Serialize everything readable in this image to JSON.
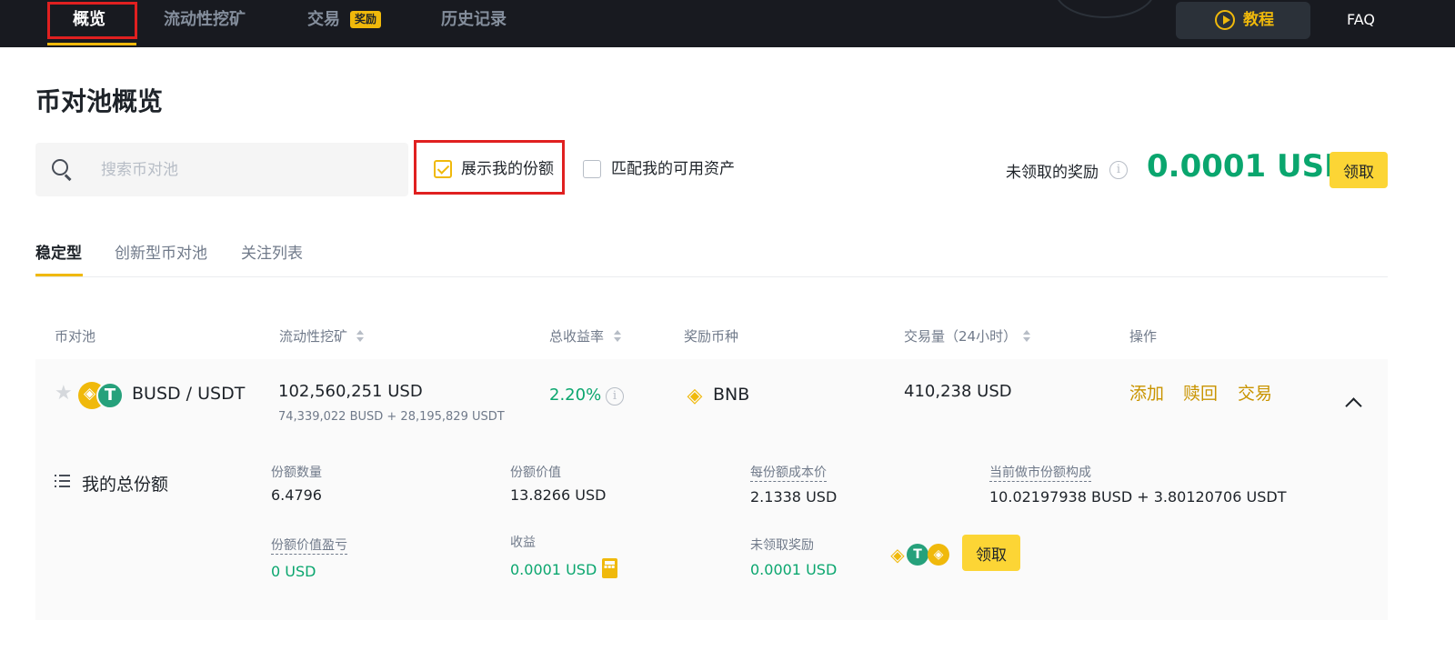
{
  "nav": {
    "items": [
      {
        "label": "概览"
      },
      {
        "label": "流动性挖矿"
      },
      {
        "label": "交易",
        "badge": "奖励"
      },
      {
        "label": "历史记录"
      }
    ],
    "tutorial_label": "教程",
    "faq_label": "FAQ"
  },
  "page": {
    "title": "币对池概览"
  },
  "filters": {
    "search_placeholder": "搜索币对池",
    "show_my_share": {
      "label": "展示我的份额",
      "checked": true
    },
    "match_assets": {
      "label": "匹配我的可用资产",
      "checked": false
    }
  },
  "reward": {
    "label": "未领取的奖励",
    "amount": "0.0001 USD",
    "claim_label": "领取"
  },
  "tabs": [
    {
      "label": "稳定型",
      "active": true
    },
    {
      "label": "创新型币对池"
    },
    {
      "label": "关注列表"
    }
  ],
  "table": {
    "headers": [
      "币对池",
      "流动性挖矿",
      "总收益率",
      "奖励币种",
      "交易量（24小时）",
      "操作"
    ],
    "rows": [
      {
        "pair": "BUSD / USDT",
        "liquidity": "102,560,251 USD",
        "liquidity_breakdown": "74,339,022 BUSD + 28,195,829 USDT",
        "apy": "2.20%",
        "reward_coin": "BNB",
        "volume": "410,238 USD",
        "actions": [
          "添加",
          "赎回",
          "交易"
        ]
      }
    ]
  },
  "my_share": {
    "title": "我的总份额",
    "share_count_label": "份额数量",
    "share_count": "6.4796",
    "share_value_label": "份额价值",
    "share_value": "13.8266 USD",
    "cost_per_share_label": "每份额成本价",
    "cost_per_share": "2.1338 USD",
    "composition_label": "当前做市份额构成",
    "composition": "10.02197938 BUSD + 3.80120706 USDT",
    "pnl_label": "份额价值盈亏",
    "pnl": "0 USD",
    "earnings_label": "收益",
    "earnings": "0.0001 USD",
    "unclaimed_label": "未领取奖励",
    "unclaimed": "0.0001 USD",
    "claim_label": "领取"
  },
  "colors": {
    "accent": "#f0b90b",
    "positive": "#0aa66e",
    "nav_bg": "#181a20",
    "highlight_box": "#e02020"
  }
}
